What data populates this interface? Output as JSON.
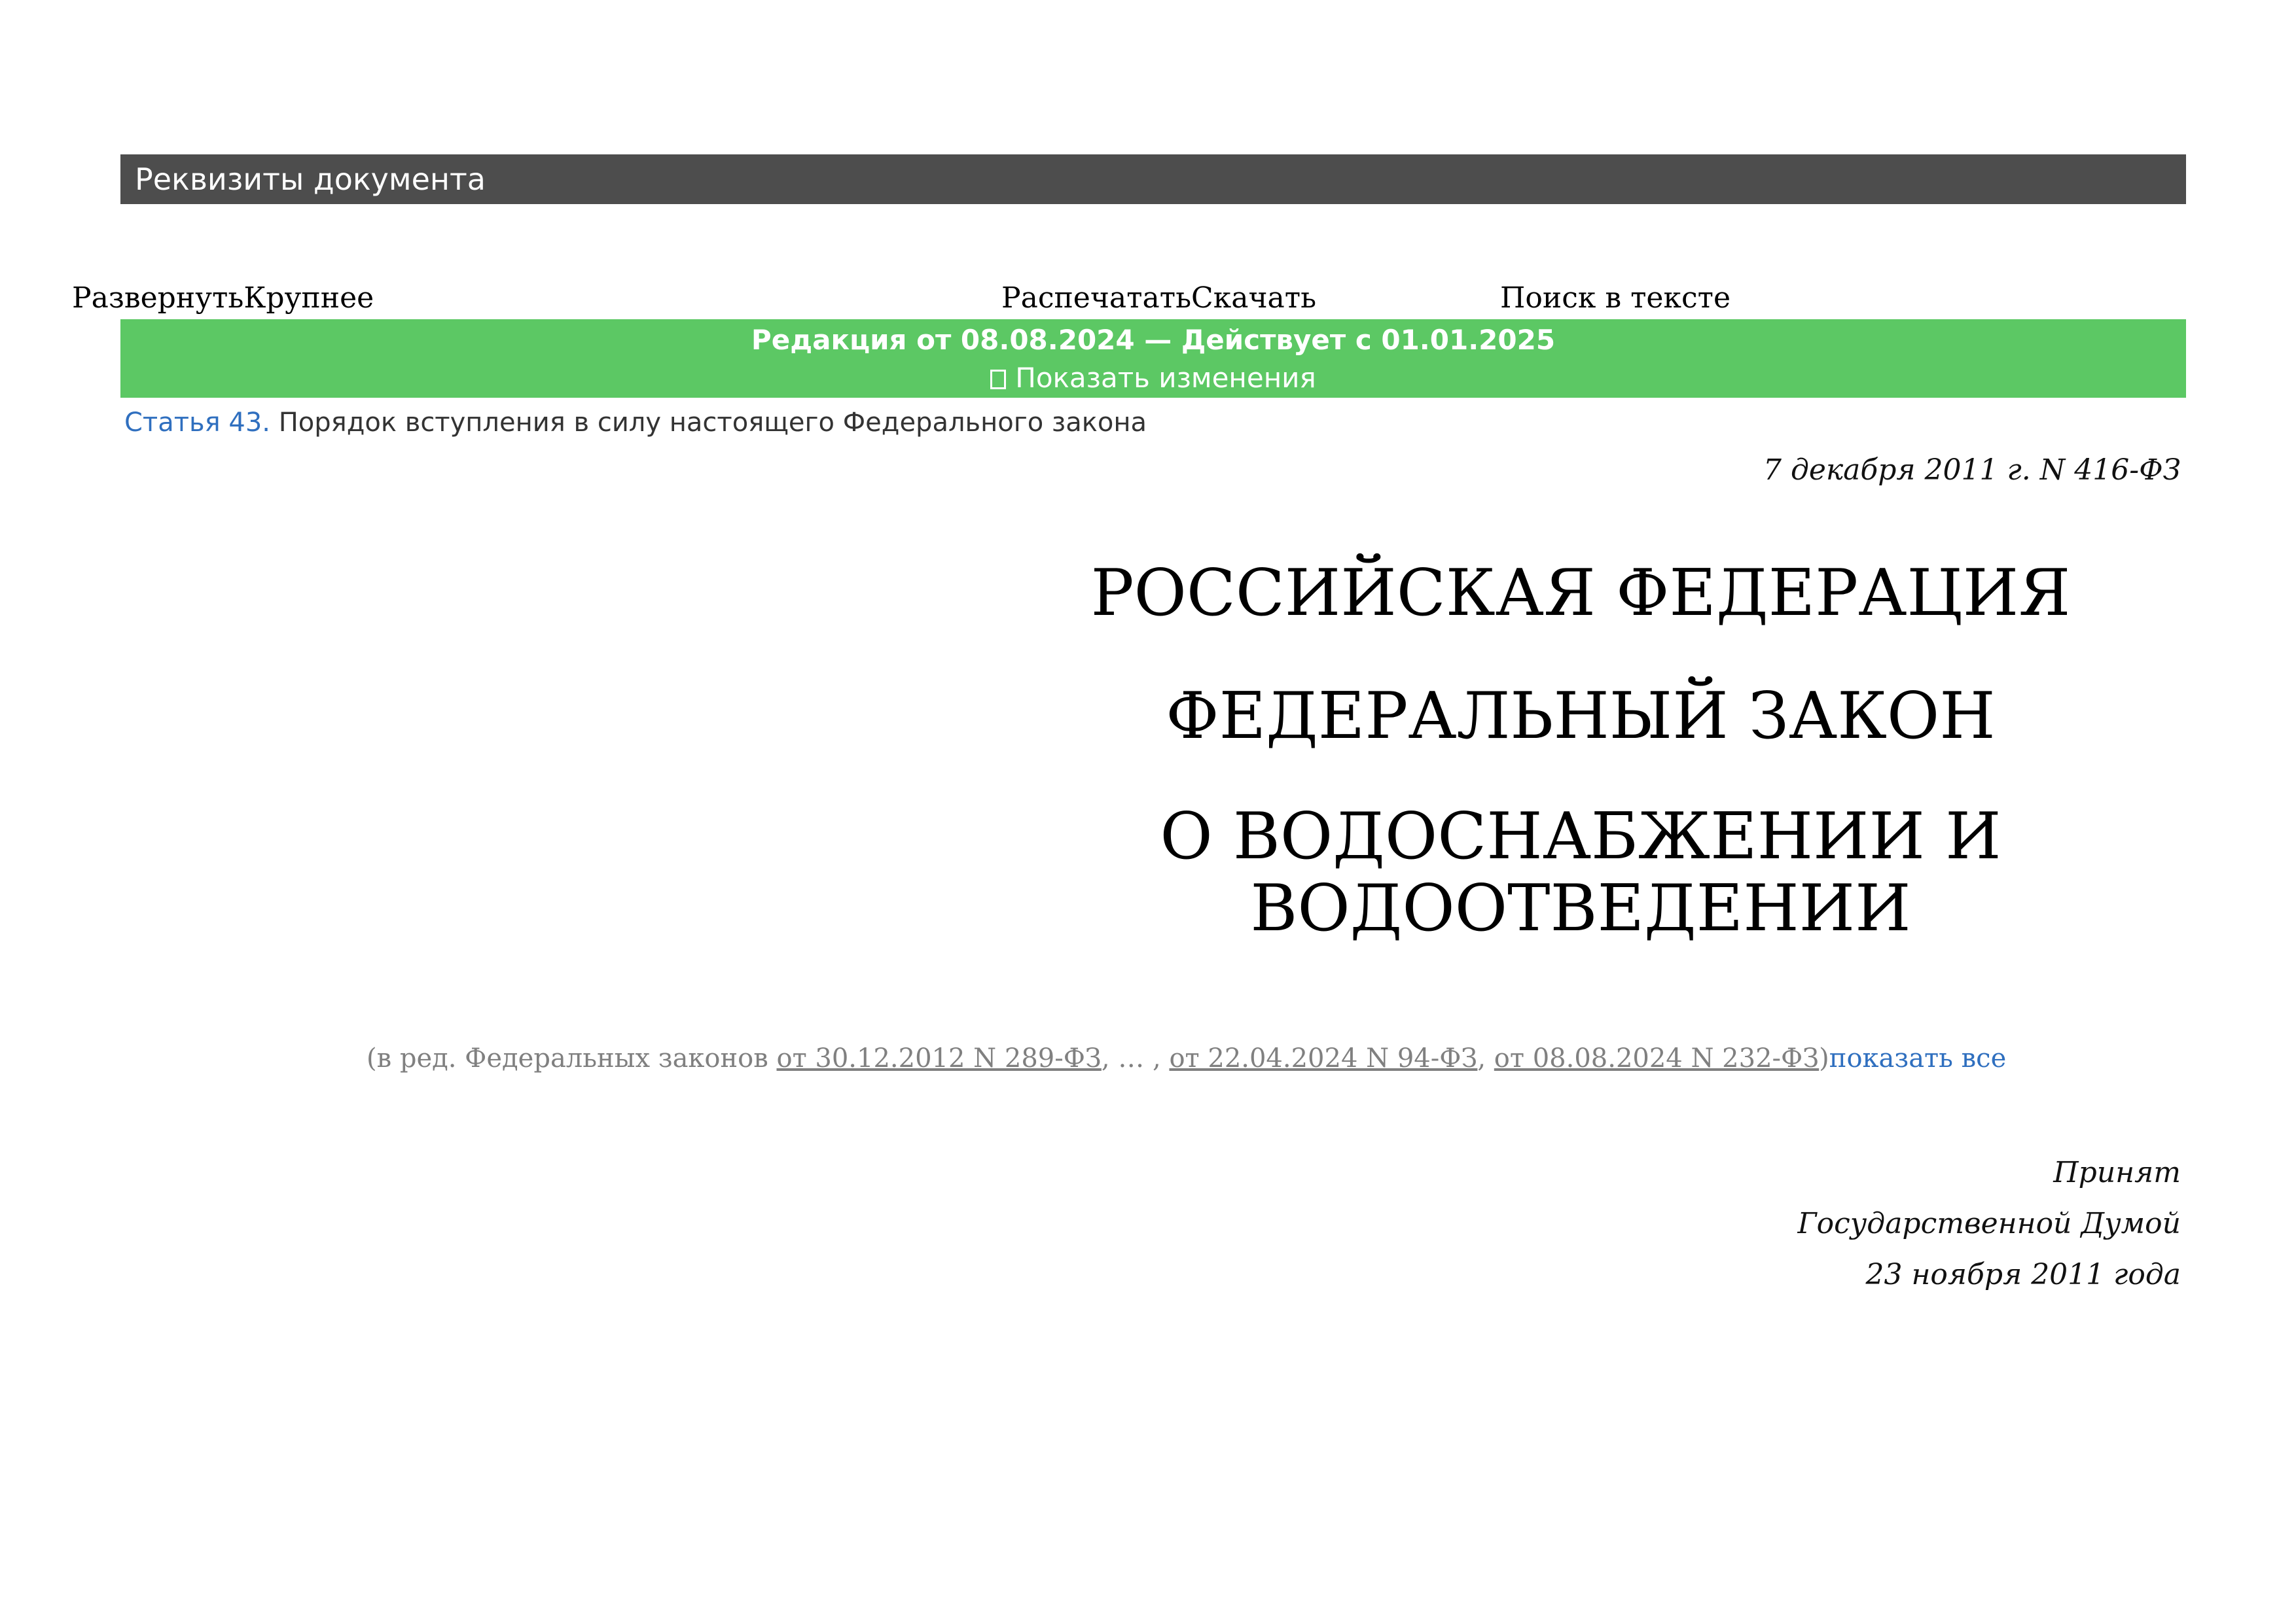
{
  "header": {
    "rekvizity_label": "Реквизиты документа"
  },
  "toolbar": {
    "expand": "Развернуть",
    "larger": "Крупнее",
    "print": "Распечатать",
    "download": "Скачать",
    "search": "Поиск в тексте"
  },
  "banner": {
    "edition": "Редакция от 08.08.2024 — Действует с 01.01.2025",
    "show_changes": "Показать изменения",
    "color": "#5cc864"
  },
  "article": {
    "link": "Статья 43.",
    "text": " Порядок вступления в силу настоящего Федерального закона"
  },
  "document": {
    "date_number": "7 декабря 2011 г. N 416-ФЗ",
    "title_1": "РОССИЙСКАЯ ФЕДЕРАЦИЯ",
    "title_2": "ФЕДЕРАЛЬНЫЙ ЗАКОН",
    "title_3a": "О ВОДОСНАБЖЕНИИ И",
    "title_3b": "ВОДООТВЕДЕНИИ"
  },
  "amendments": {
    "prefix": "(в ред. Федеральных законов ",
    "law_1": "от 30.12.2012 N 289-ФЗ",
    "sep_1": ", … , ",
    "law_2": "от 22.04.2024 N 94-ФЗ",
    "sep_2": ", ",
    "law_3": "от 08.08.2024 N 232-ФЗ",
    "suffix": ")",
    "show_all": "показать все"
  },
  "adoption": {
    "line_1": "Принят",
    "line_2": "Государственной Думой",
    "line_3": "23 ноября 2011 года"
  }
}
